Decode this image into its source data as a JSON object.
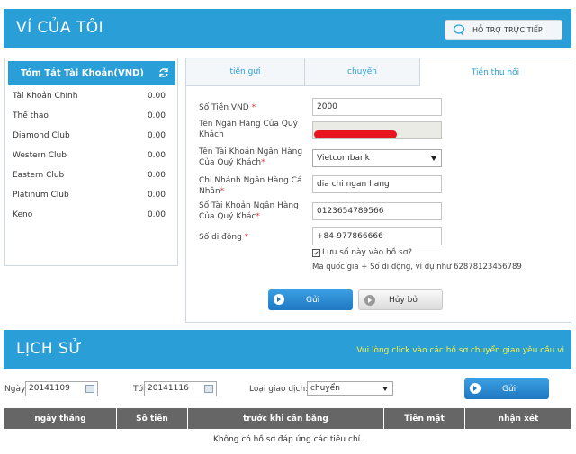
{
  "header": {
    "title": "VÍ CỦA TÔI",
    "support_label": "HỖ TRỢ TRỰC TIẾP"
  },
  "summary": {
    "title": "Tóm Tắt Tài Khoản(VND)",
    "accounts": [
      {
        "name": "Tài Khoản Chính",
        "value": "0.00"
      },
      {
        "name": "Thể thao",
        "value": "0.00"
      },
      {
        "name": "Diamond Club",
        "value": "0.00"
      },
      {
        "name": "Western Club",
        "value": "0.00"
      },
      {
        "name": "Eastern Club",
        "value": "0.00"
      },
      {
        "name": "Platinum Club",
        "value": "0.00"
      },
      {
        "name": "Keno",
        "value": "0.00"
      }
    ]
  },
  "tabs": [
    {
      "label": "tiền gửi"
    },
    {
      "label": "chuyển"
    },
    {
      "label": "Tiền thu hồi"
    }
  ],
  "form": {
    "amount_label": "Số Tiền VND",
    "amount_value": "2000",
    "bank_name_label": "Tên Ngân Hàng Của Quý Khách",
    "account_name_label": "Tên Tài Khoản Ngân Hàng Của Quý Khách",
    "account_name_value": "Vietcombank",
    "branch_label": "Chi Nhánh Ngân Hàng Cá Nhân",
    "branch_value": "dia chi ngan hang",
    "account_number_label": "Số Tài Khoản Ngân Hàng Của Quý Khác",
    "account_number_value": "0123654789566",
    "phone_label": "Số di động",
    "phone_value": "+84-977866666",
    "save_label": "Lưu số này vào hồ sơ?",
    "hint": "Mã quốc gia + Số di động, ví dụ như 62878123456789",
    "required_mark": "*",
    "submit_label": "Gửi",
    "cancel_label": "Hủy bỏ"
  },
  "history": {
    "title": "LỊCH SỬ",
    "notice": "Vui lòng click vào các hồ sơ chuyển giao yêu cầu vì",
    "date_label": "Ngày",
    "from_date": "20141109",
    "to_label": "Tới",
    "to_date": "20141116",
    "type_label": "Loại giao dịch:",
    "type_value": "chuyển",
    "submit_label": "Gửi",
    "columns": [
      "ngày tháng",
      "Số tiền",
      "trước khi cân bằng",
      "Tiền mặt",
      "nhận xét"
    ],
    "empty_message": "Không có hồ sơ đáp ứng các tiêu chí."
  },
  "colors": {
    "accent": "#2a9ed6",
    "notice": "#ffef3a",
    "required": "#d9363e"
  }
}
